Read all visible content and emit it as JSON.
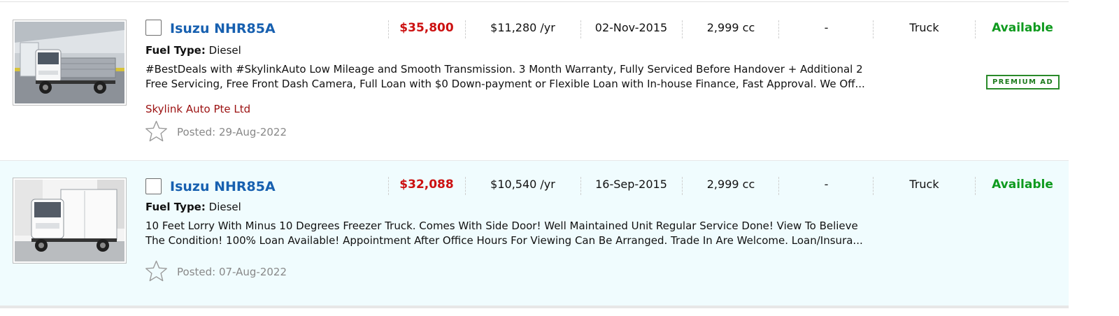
{
  "listings": [
    {
      "title": "Isuzu NHR85A",
      "price": "$35,800",
      "depreciation": "$11,280 /yr",
      "reg_date": "02-Nov-2015",
      "engine": "2,999 cc",
      "mileage": "-",
      "vehicle_type": "Truck",
      "status": "Available",
      "fuel_label": "Fuel Type:",
      "fuel_value": "Diesel",
      "description_line1": "#BestDeals with #SkylinkAuto Low Mileage and Smooth Transmission. 3 Month Warranty, Fully Serviced Before Handover + Additional 2",
      "description_line2": "Free Servicing, Free Front Dash Camera, Full Loan with $0 Down-payment or Flexible Loan with In-house Finance, Fast Approval. We Off...",
      "dealer": "Skylink Auto Pte Ltd",
      "posted": "Posted: 29-Aug-2022",
      "badge": "PREMIUM AD",
      "thumbnail_icon": "truck-photo-icon"
    },
    {
      "title": "Isuzu NHR85A",
      "price": "$32,088",
      "depreciation": "$10,540 /yr",
      "reg_date": "16-Sep-2015",
      "engine": "2,999 cc",
      "mileage": "-",
      "vehicle_type": "Truck",
      "status": "Available",
      "fuel_label": "Fuel Type:",
      "fuel_value": "Diesel",
      "description_line1": "10 Feet Lorry With Minus 10 Degrees Freezer Truck. Comes With Side Door! Well Maintained Unit Regular Service Done! View To Believe",
      "description_line2": "The Condition! 100% Loan Available! Appointment After Office Hours For Viewing Can Be Arranged. Trade In Are Welcome. Loan/Insura...",
      "posted": "Posted: 07-Aug-2022",
      "thumbnail_icon": "freezer-truck-photo-icon"
    }
  ],
  "colors": {
    "title": "#1760b0",
    "price": "#cc1111",
    "status": "#0e9a1e",
    "dealer": "#9b1010",
    "premium_badge": "#2a8a2a",
    "alt_row_background": "#f0fcfe"
  }
}
